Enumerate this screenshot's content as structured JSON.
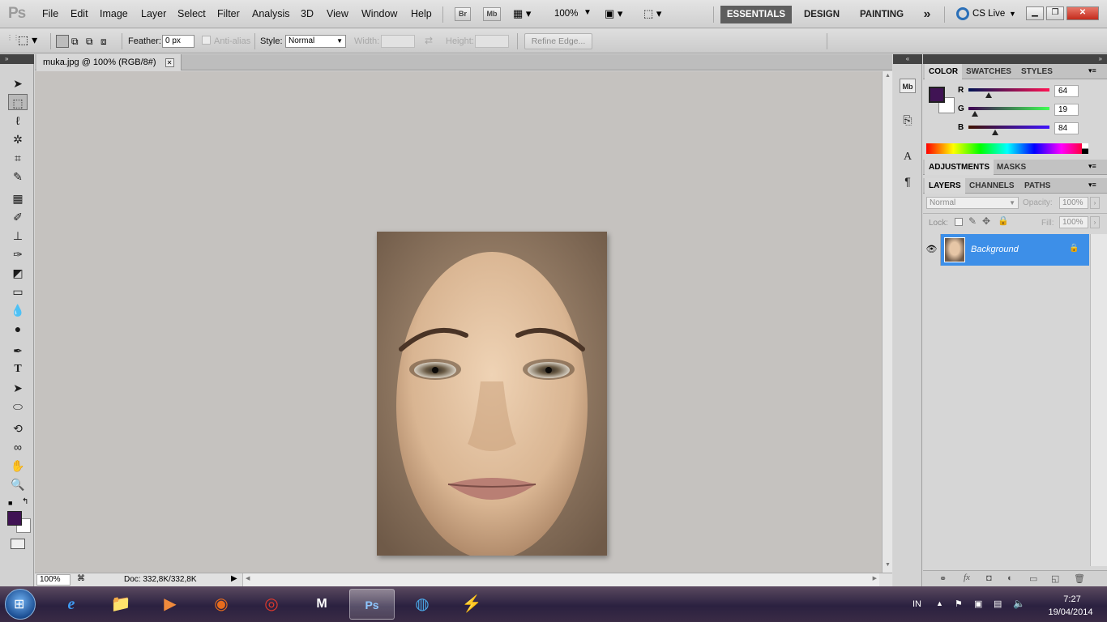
{
  "menubar": {
    "logo": "Ps",
    "items": [
      "File",
      "Edit",
      "Image",
      "Layer",
      "Select",
      "Filter",
      "Analysis",
      "3D",
      "View",
      "Window",
      "Help"
    ],
    "bridge": "Br",
    "minibridge": "Mb",
    "zoom": "100%",
    "workspaces": [
      "ESSENTIALS",
      "DESIGN",
      "PAINTING"
    ],
    "more": "»",
    "cslive": "CS Live"
  },
  "options": {
    "feather_label": "Feather:",
    "feather_value": "0 px",
    "antialias_label": "Anti-alias",
    "style_label": "Style:",
    "style_value": "Normal",
    "width_label": "Width:",
    "height_label": "Height:",
    "refine_label": "Refine Edge..."
  },
  "document": {
    "tab_title": "muka.jpg @ 100% (RGB/8#)",
    "zoom": "100%",
    "doc_info": "Doc: 332,8K/332,8K"
  },
  "color_panel": {
    "tabs": [
      "COLOR",
      "SWATCHES",
      "STYLES"
    ],
    "r": {
      "label": "R",
      "value": "64",
      "fraction": 0.25
    },
    "g": {
      "label": "G",
      "value": "19",
      "fraction": 0.075
    },
    "b": {
      "label": "B",
      "value": "84",
      "fraction": 0.33
    },
    "fg_color": "#401354",
    "bg_color": "#ffffff"
  },
  "adjust_panel": {
    "tabs": [
      "ADJUSTMENTS",
      "MASKS"
    ]
  },
  "layers_panel": {
    "tabs": [
      "LAYERS",
      "CHANNELS",
      "PATHS"
    ],
    "blend_mode": "Normal",
    "opacity_label": "Opacity:",
    "opacity_value": "100%",
    "lock_label": "Lock:",
    "fill_label": "Fill:",
    "fill_value": "100%",
    "layers": [
      {
        "name": "Background",
        "selected": true
      }
    ]
  },
  "taskbar": {
    "lang": "IN",
    "time": "7:27",
    "date": "19/04/2014"
  }
}
